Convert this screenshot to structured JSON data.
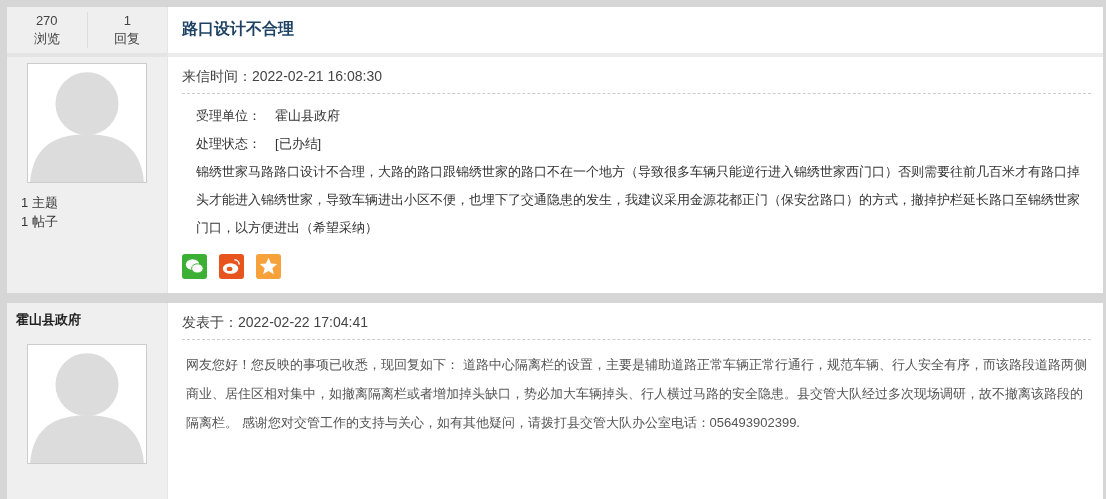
{
  "topic": {
    "stats": [
      {
        "value": "270",
        "label": "浏览"
      },
      {
        "value": "1",
        "label": "回复"
      }
    ],
    "title": "路口设计不合理",
    "author_stats": [
      "1 主题",
      "1 帖子"
    ],
    "time_label": "来信时间：2022-02-21 16:08:30",
    "fields": [
      {
        "label": "受理单位：",
        "value": "霍山县政府"
      },
      {
        "label": "处理状态：",
        "value": "[已办结]"
      }
    ],
    "body": "锦绣世家马路路口设计不合理，大路的路口跟锦绣世家的路口不在一个地方（导致很多车辆只能逆行进入锦绣世家西门口）否则需要往前几百米才有路口掉头才能进入锦绣世家，导致车辆进出小区不便，也埋下了交通隐患的发生，我建议采用金源花都正门（保安岔路口）的方式，撤掉护栏延长路口至锦绣世家门口，以方便进出（希望采纳）",
    "share": [
      {
        "kind": "wechat"
      },
      {
        "kind": "weibo"
      },
      {
        "kind": "qzone"
      }
    ]
  },
  "reply": {
    "author": "霍山县政府",
    "time_label": "发表于：2022-02-22 17:04:41",
    "body": "网友您好！您反映的事项已收悉，现回复如下： 道路中心隔离栏的设置，主要是辅助道路正常车辆正常行通行，规范车辆、行人安全有序，而该路段道路两侧商业、居住区相对集中，如撤离隔离栏或者增加掉头缺口，势必加大车辆掉头、行人横过马路的安全隐患。县交管大队经过多次现场调研，故不撤离该路段的隔离栏。 感谢您对交管工作的支持与关心，如有其他疑问，请拨打县交管大队办公室电话：056493902399."
  }
}
